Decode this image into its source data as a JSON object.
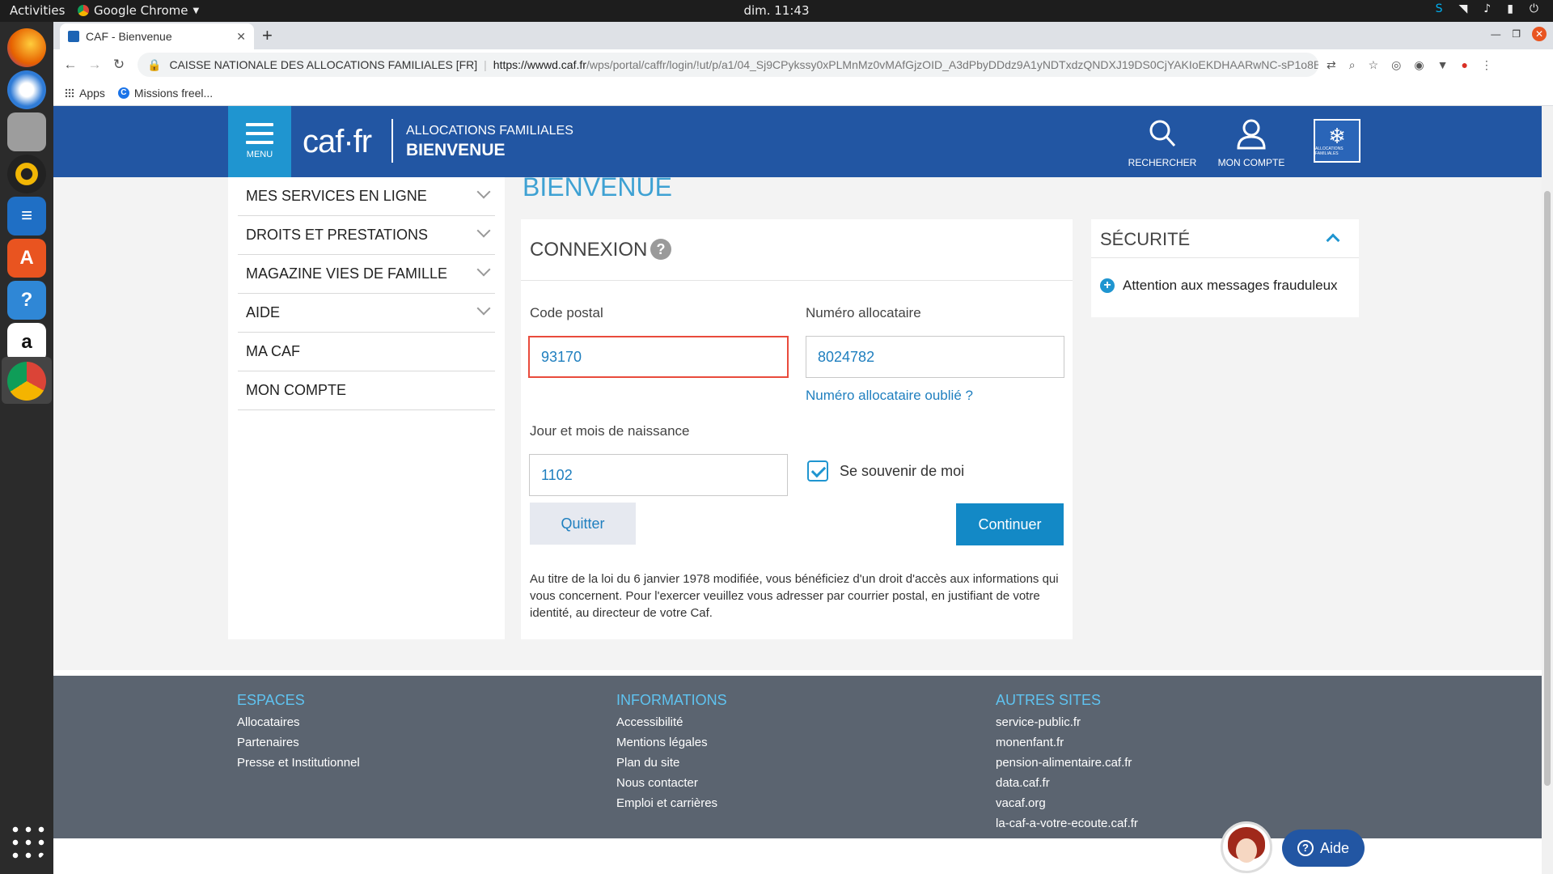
{
  "system": {
    "activities": "Activities",
    "app_name": "Google Chrome",
    "clock": "dim. 11:43"
  },
  "browser": {
    "tab_title": "CAF - Bienvenue",
    "site_identity": "CAISSE NATIONALE DES ALLOCATIONS FAMILIALES [FR]",
    "url_host": "https://wwwd.caf.fr",
    "url_path": "/wps/portal/caffr/login/!ut/p/a1/04_Sj9CPykssy0xPLMnMz0vMAfGjzOID_A3dPbyDDdz9A1yNDTxdzQNDXJ19DS0CjYAKIoEKDHAARwNC-sP1o8B...",
    "bookmarks": [
      "Apps",
      "Missions freel..."
    ]
  },
  "header": {
    "menu_label": "MENU",
    "logo": "caf·fr",
    "subtitle_line1": "ALLOCATIONS FAMILIALES",
    "subtitle_line2": "BIENVENUE",
    "search_label": "RECHERCHER",
    "account_label": "MON COMPTE",
    "brand_logo_text": "ALLOCATIONS FAMILIALES"
  },
  "nav": {
    "items": [
      {
        "label": "MES SERVICES EN LIGNE",
        "expandable": true
      },
      {
        "label": "DROITS ET PRESTATIONS",
        "expandable": true
      },
      {
        "label": "MAGAZINE VIES DE FAMILLE",
        "expandable": true
      },
      {
        "label": "AIDE",
        "expandable": true
      },
      {
        "label": "MA CAF",
        "expandable": false
      },
      {
        "label": "MON COMPTE",
        "expandable": false
      }
    ]
  },
  "page": {
    "title": "BIENVENUE"
  },
  "login": {
    "title": "CONNEXION",
    "postal_label": "Code postal",
    "postal_value": "93170",
    "alloc_label": "Numéro allocataire",
    "alloc_value": "8024782",
    "forgot_link": "Numéro allocataire oublié ?",
    "birth_label": "Jour et mois de naissance",
    "birth_value": "1102",
    "remember_label": "Se souvenir de moi",
    "remember_checked": true,
    "quit_label": "Quitter",
    "continue_label": "Continuer",
    "legal_text": "Au titre de la loi du 6 janvier 1978 modifiée, vous bénéficiez d'un droit d'accès aux informations qui vous concernent. Pour l'exercer veuillez vous adresser par courrier postal, en justifiant de votre identité, au directeur de votre Caf."
  },
  "security": {
    "title": "SÉCURITÉ",
    "link": "Attention aux messages frauduleux"
  },
  "footer": {
    "columns": [
      {
        "title": "ESPACES",
        "links": [
          "Allocataires",
          "Partenaires",
          "Presse et Institutionnel"
        ]
      },
      {
        "title": "INFORMATIONS",
        "links": [
          "Accessibilité",
          "Mentions légales",
          "Plan du site",
          "Nous contacter",
          "Emploi et carrières"
        ]
      },
      {
        "title": "AUTRES SITES",
        "links": [
          "service-public.fr",
          "monenfant.fr",
          "pension-alimentaire.caf.fr",
          "data.caf.fr",
          "vacaf.org",
          "la-caf-a-votre-ecoute.caf.fr"
        ]
      }
    ]
  },
  "chat": {
    "button_label": "Aide"
  },
  "colors": {
    "header_bg": "#2256a3",
    "accent": "#1f95d0",
    "error_border": "#e94b3c",
    "footer_bg": "#5b6470",
    "footer_heading": "#5fc3f0"
  }
}
